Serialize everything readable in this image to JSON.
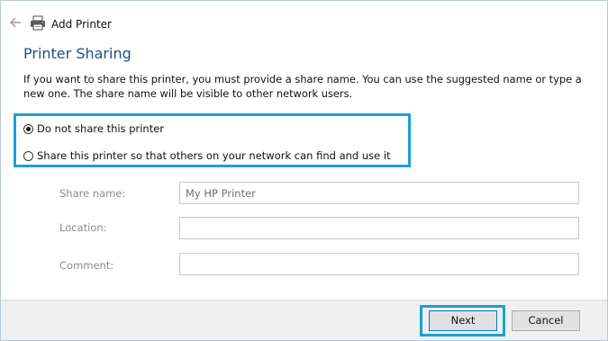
{
  "window": {
    "title": "Add Printer"
  },
  "page": {
    "title": "Printer Sharing",
    "description": "If you want to share this printer, you must provide a share name. You can use the suggested name or type a new one. The share name will be visible to other network users."
  },
  "sharing_options": [
    {
      "label": "Do not share this printer",
      "selected": true
    },
    {
      "label": "Share this printer so that others on your network can find and use it",
      "selected": false
    }
  ],
  "fields": {
    "share_name": {
      "label": "Share name:",
      "value": "My HP Printer"
    },
    "location": {
      "label": "Location:",
      "value": ""
    },
    "comment": {
      "label": "Comment:",
      "value": ""
    }
  },
  "buttons": {
    "next": "Next",
    "cancel": "Cancel"
  },
  "colors": {
    "title_blue": "#1f4e8c",
    "highlight": "#19a0d9"
  }
}
